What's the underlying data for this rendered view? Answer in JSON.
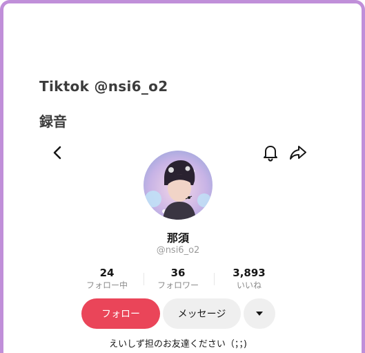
{
  "post": {
    "title": "Tiktok  @nsi6_o2",
    "subtitle": "録音"
  },
  "nav": {
    "back_icon": "chevron-left-icon",
    "bell_icon": "bell-icon",
    "share_icon": "share-arrow-icon"
  },
  "profile": {
    "display_name": "那須",
    "handle": "@nsi6_o2",
    "bio": "えいしず担のお友達ください（；；)"
  },
  "stats": {
    "following": {
      "value": "24",
      "label": "フォロー中"
    },
    "followers": {
      "value": "36",
      "label": "フォロワー"
    },
    "likes": {
      "value": "3,893",
      "label": "いいね"
    }
  },
  "actions": {
    "follow_label": "フォロー",
    "message_label": "メッセージ",
    "more_icon": "caret-down-icon"
  },
  "colors": {
    "frame_border": "#c08fd9",
    "follow_button": "#ea4559",
    "secondary_button": "#efefef"
  }
}
